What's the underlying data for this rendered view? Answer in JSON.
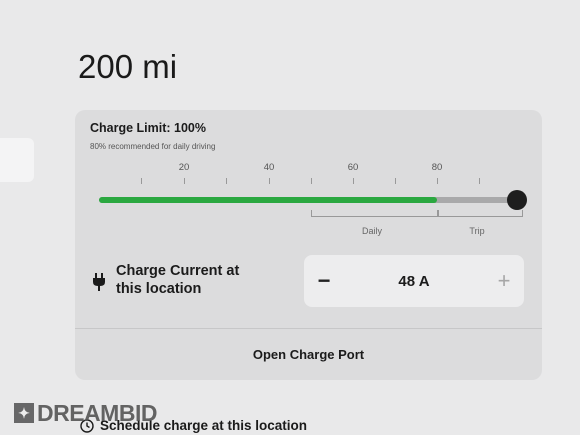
{
  "range": {
    "value": "200 mi"
  },
  "charge_limit": {
    "title": "Charge Limit: 100%",
    "subtitle": "80% recommended for daily driving",
    "level": 1.0,
    "tick_labels": [
      "20",
      "40",
      "60",
      "80"
    ],
    "zones": [
      "Daily",
      "Trip"
    ],
    "colors": {
      "fill": "#2ba840",
      "track": "#a9a9aa",
      "knob": "#1e1e1e"
    }
  },
  "charge_current": {
    "label": "Charge Current at this location",
    "value": "48 A",
    "decrease_label": "−",
    "increase_label": "+",
    "icon": "plug-icon"
  },
  "open_port": {
    "label": "Open Charge Port"
  },
  "schedule": {
    "label": "Schedule charge at this location",
    "icon": "clock-icon"
  },
  "watermark": {
    "mark": "✦",
    "text": "DREAMBID"
  }
}
